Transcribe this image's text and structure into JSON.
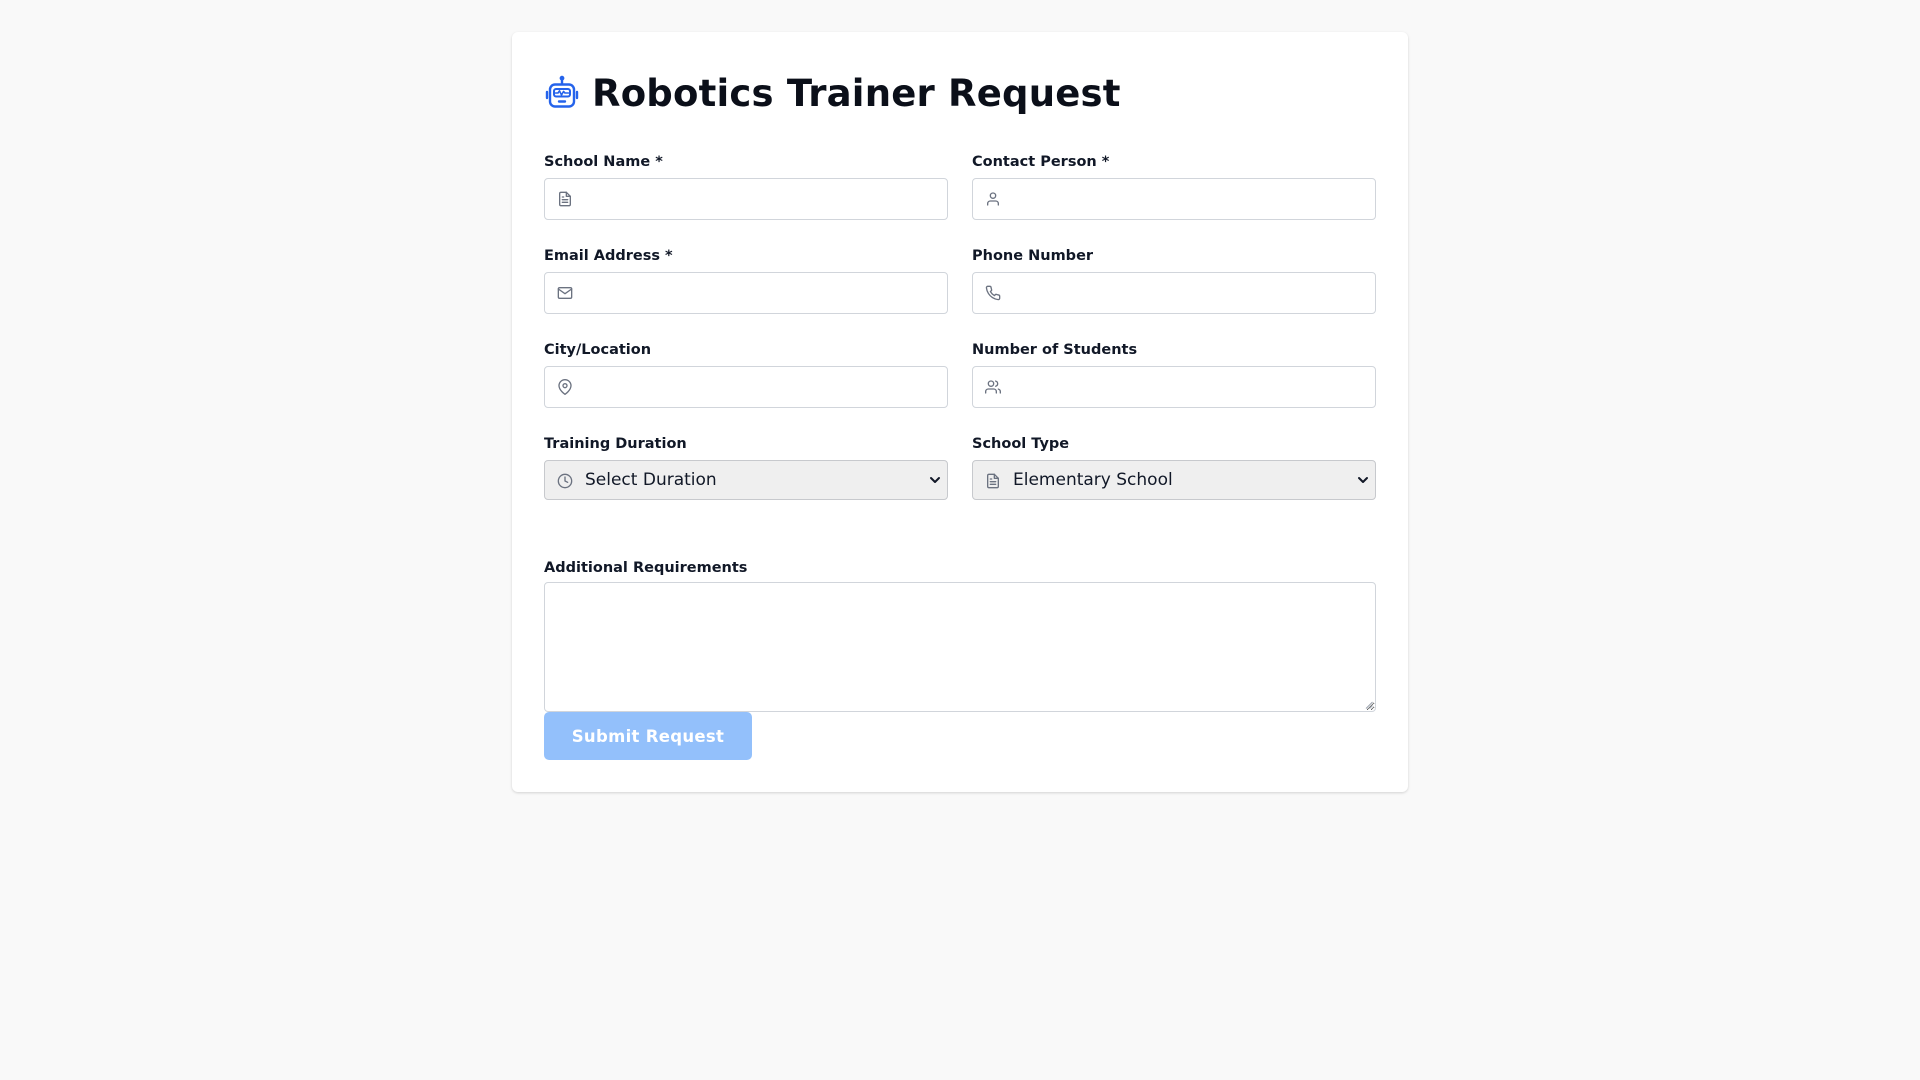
{
  "header": {
    "title": "Robotics Trainer Request",
    "icon": "robot-icon"
  },
  "colors": {
    "accent": "#2563eb",
    "button_disabled": "#93c0fb",
    "background": "#f9f9f9",
    "icon_gray": "#6b7280"
  },
  "form": {
    "school_name": {
      "label": "School Name *",
      "value": "",
      "placeholder": "",
      "icon": "document-icon"
    },
    "contact_person": {
      "label": "Contact Person *",
      "value": "",
      "placeholder": "",
      "icon": "user-icon"
    },
    "email": {
      "label": "Email Address *",
      "value": "",
      "placeholder": "",
      "icon": "mail-icon"
    },
    "phone": {
      "label": "Phone Number",
      "value": "",
      "placeholder": "",
      "icon": "phone-icon"
    },
    "city": {
      "label": "City/Location",
      "value": "",
      "placeholder": "",
      "icon": "map-pin-icon"
    },
    "students": {
      "label": "Number of Students",
      "value": "",
      "placeholder": "",
      "icon": "users-icon"
    },
    "duration": {
      "label": "Training Duration",
      "selected": "Select Duration",
      "icon": "clock-icon"
    },
    "school_type": {
      "label": "School Type",
      "selected": "Elementary School",
      "icon": "document-icon"
    },
    "requirements": {
      "label": "Additional Requirements",
      "value": ""
    },
    "submit_label": "Submit Request"
  }
}
